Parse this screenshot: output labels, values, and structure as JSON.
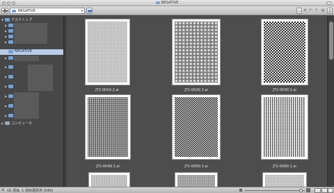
{
  "window": {
    "title": "NEGATIVE"
  },
  "toolbar": {
    "path_value": "NEGATIVE",
    "back_icon": "back-arrow-icon",
    "forward_icon": "forward-arrow-icon"
  },
  "sidebar": {
    "desktop_label": "デスクトップ",
    "selected_folder": "NEGATIVE",
    "computer_label": "コンピュータ"
  },
  "files": [
    {
      "name": "JT2-001N 2.ai",
      "pattern": "grid"
    },
    {
      "name": "JT2-002N 2.ai",
      "pattern": "circles"
    },
    {
      "name": "JT2-003N 2.ai",
      "pattern": "checker"
    },
    {
      "name": "JT2-004N 2.ai",
      "pattern": "diamond"
    },
    {
      "name": "JT2-005N 2.ai",
      "pattern": "fine-checker"
    },
    {
      "name": "JT2-006N 2.ai",
      "pattern": "stripes"
    }
  ],
  "status": {
    "text": "16 項目, 1 項目選択済 (549)"
  }
}
